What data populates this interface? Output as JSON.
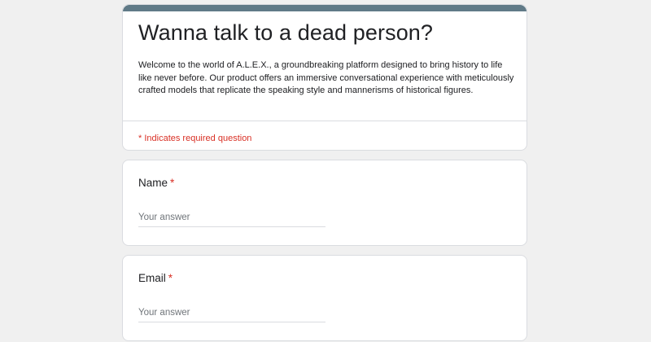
{
  "form": {
    "title": "Wanna talk to a dead person?",
    "description": "Welcome to the world of A.L.E.X., a groundbreaking platform designed to bring history to life like never before. Our product offers an immersive conversational experience with meticulously crafted models that replicate the speaking style and mannerisms of historical figures.",
    "required_note": "* Indicates required question",
    "accent_color": "#607a87",
    "required_color": "#d93025"
  },
  "questions": [
    {
      "label": "Name",
      "required_marker": "*",
      "placeholder": "Your answer",
      "value": ""
    },
    {
      "label": "Email",
      "required_marker": "*",
      "placeholder": "Your answer",
      "value": ""
    }
  ]
}
